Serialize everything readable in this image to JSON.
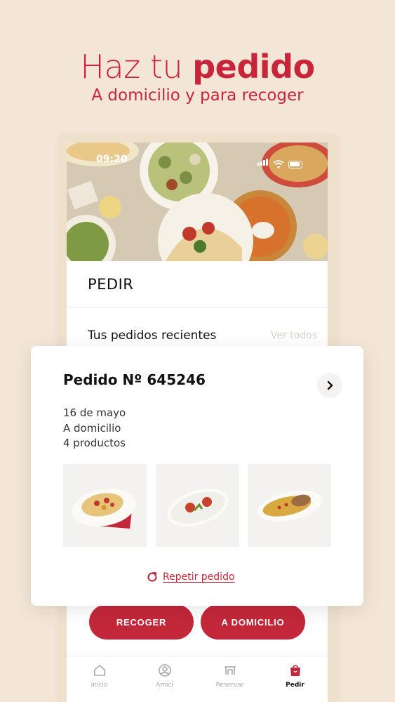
{
  "headline": {
    "title_light": "Haz tu ",
    "title_bold": "pedido",
    "subtitle": "A domicilio y para recoger"
  },
  "status_bar": {
    "time": "09:20"
  },
  "screen": {
    "title": "PEDIR",
    "recent_label": "Tus pedidos recientes",
    "see_all": "Ver todos"
  },
  "order": {
    "title": "Pedido Nº 645246",
    "date": "16 de mayo",
    "mode": "A domicilio",
    "count": "4 productos",
    "repeat_label": "Repetir pedido"
  },
  "actions": {
    "pickup": "RECOGER",
    "delivery": "A DOMICILIO"
  },
  "tabs": [
    {
      "label": "Inicio",
      "icon": "home-icon"
    },
    {
      "label": "Amici",
      "icon": "user-circle-icon"
    },
    {
      "label": "Reservar",
      "icon": "table-icon"
    },
    {
      "label": "Pedir",
      "icon": "bag-icon",
      "active": true
    }
  ],
  "colors": {
    "brand": "#c3283a",
    "background": "#f3e6d6"
  }
}
